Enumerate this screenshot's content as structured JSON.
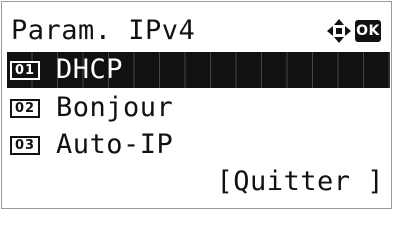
{
  "screen": {
    "title": "Param. IPv4",
    "ok_key_label": "OK",
    "nav_icon": "four-way-arrows-icon"
  },
  "menu": {
    "items": [
      {
        "number": "01",
        "label": "DHCP",
        "selected": true
      },
      {
        "number": "02",
        "label": "Bonjour",
        "selected": false
      },
      {
        "number": "03",
        "label": "Auto-IP",
        "selected": false
      }
    ]
  },
  "footer": {
    "quit_label": "[Quitter ]"
  },
  "colors": {
    "ink": "#111111",
    "background": "#ffffff",
    "highlight_bg": "#111111",
    "highlight_fg": "#ffffff"
  }
}
